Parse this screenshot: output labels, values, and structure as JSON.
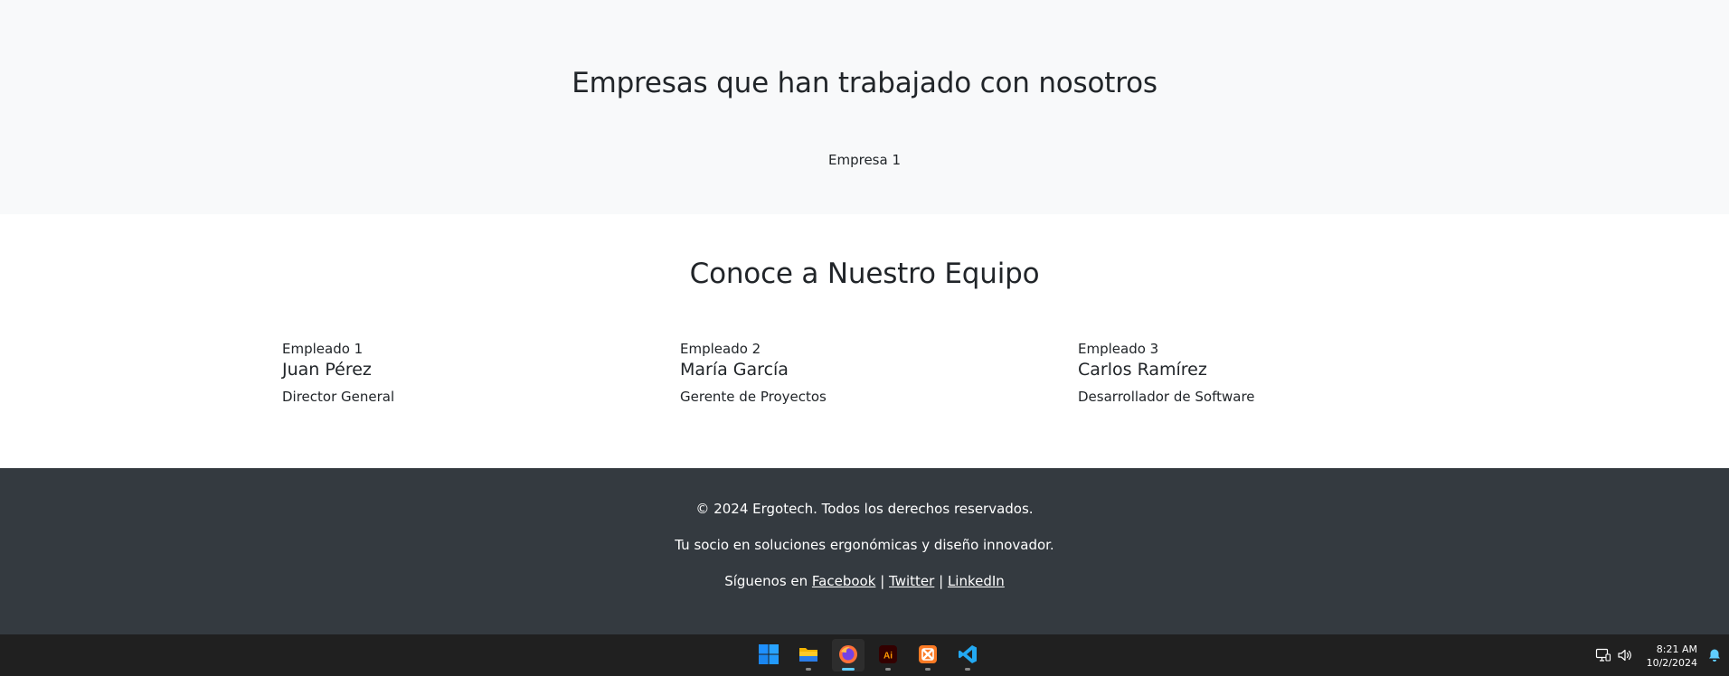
{
  "companies": {
    "title": "Empresas que han trabajado con nosotros",
    "items": [
      "Empresa 1"
    ]
  },
  "team": {
    "title": "Conoce a Nuestro Equipo",
    "members": [
      {
        "tag": "Empleado 1",
        "name": "Juan Pérez",
        "role": "Director General"
      },
      {
        "tag": "Empleado 2",
        "name": "María García",
        "role": "Gerente de Proyectos"
      },
      {
        "tag": "Empleado 3",
        "name": "Carlos Ramírez",
        "role": "Desarrollador de Software"
      }
    ]
  },
  "footer": {
    "copyright": "© 2024 Ergotech. Todos los derechos reservados.",
    "tagline": "Tu socio en soluciones ergonómicas y diseño innovador.",
    "follow_prefix": "Síguenos en",
    "separator": "|",
    "links": [
      "Facebook",
      "Twitter",
      "LinkedIn"
    ]
  },
  "taskbar": {
    "apps": [
      {
        "icon": "windows-start-icon"
      },
      {
        "icon": "file-explorer-icon"
      },
      {
        "icon": "firefox-icon",
        "active": true
      },
      {
        "icon": "adobe-illustrator-icon",
        "label": "Ai"
      },
      {
        "icon": "xampp-icon"
      },
      {
        "icon": "vscode-icon"
      }
    ],
    "tray_icons": [
      "network-icon",
      "volume-icon",
      "notification-bell-icon"
    ],
    "time": "8:21 AM",
    "date": "10/2/2024"
  },
  "colors": {
    "section_light": "#f8f9fa",
    "footer_bg": "#343a40",
    "taskbar_bg": "#202020",
    "text_dark": "#212529",
    "active_indicator": "#60cdff"
  }
}
